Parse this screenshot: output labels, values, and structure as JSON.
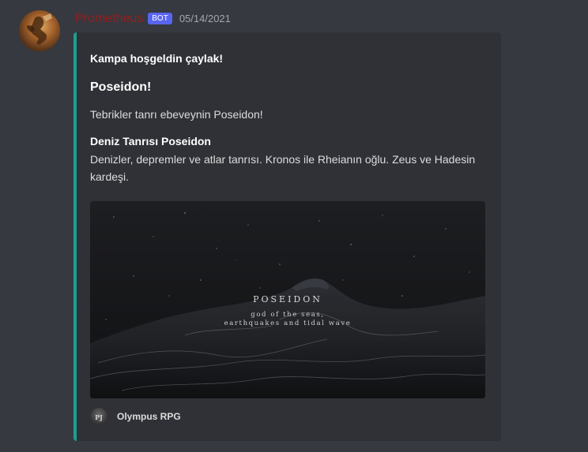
{
  "message": {
    "username": "Prometheus",
    "bot_badge": "BOT",
    "timestamp": "05/14/2021",
    "username_color": "#9b1c1c"
  },
  "embed": {
    "accent_color": "#1f9e8e",
    "author": "Kampa hoşgeldin çaylak!",
    "title": "Poseidon!",
    "description": "Tebrikler tanrı ebeveynin Poseidon!",
    "field": {
      "name": "Deniz Tanrısı Poseidon",
      "value": "Denizler, depremler ve atlar tanrısı. Kronos ile Rheianın oğlu. Zeus ve Hadesin kardeşi."
    },
    "image": {
      "title": "POSEIDON",
      "line1": "god of the seas,",
      "line2": "earthquakes and tidal wave"
    },
    "footer": {
      "text": "Olympus RPG",
      "icon_label": "PJ"
    }
  }
}
